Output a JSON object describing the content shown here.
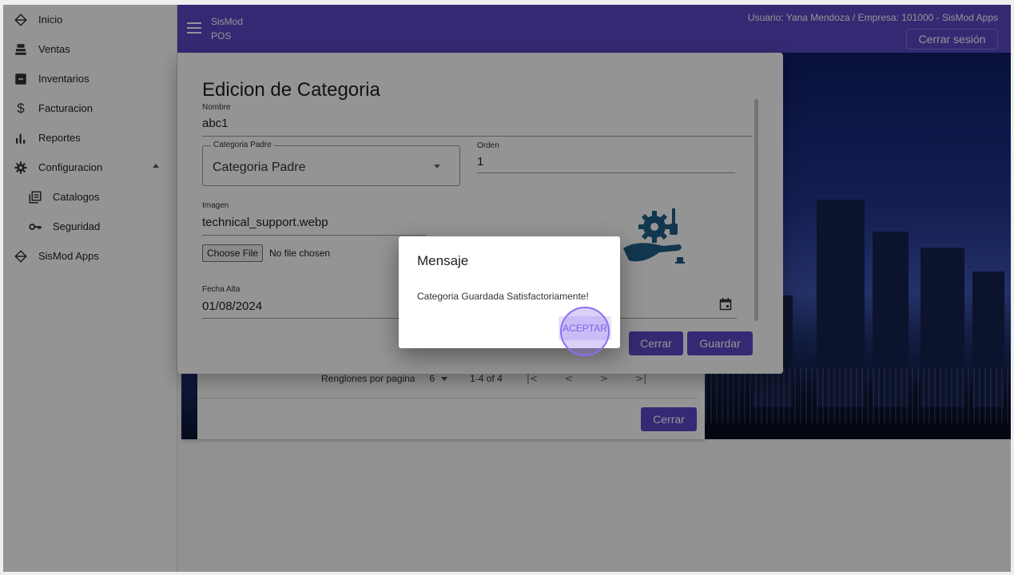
{
  "sidebar": {
    "items": [
      {
        "label": "Inicio",
        "icon": "box-outline-icon"
      },
      {
        "label": "Ventas",
        "icon": "cash-register-icon"
      },
      {
        "label": "Inventarios",
        "icon": "archive-icon"
      },
      {
        "label": "Facturacion",
        "icon": "dollar-icon"
      },
      {
        "label": "Reportes",
        "icon": "bar-chart-icon"
      },
      {
        "label": "Configuracion",
        "icon": "gear-icon"
      },
      {
        "label": "Catalogos",
        "icon": "library-books-icon"
      },
      {
        "label": "Seguridad",
        "icon": "key-icon"
      },
      {
        "label": "SisMod Apps",
        "icon": "box-outline-icon"
      }
    ]
  },
  "appbar": {
    "title_line1": "SisMod",
    "title_line2": "POS",
    "user_info": "Usuario: Yana Mendoza / Empresa: 101000 - SisMod Apps",
    "logout_label": "Cerrar sesión"
  },
  "back_panel": {
    "rows_per_page_label": "Renglones por pagina",
    "rows_per_page_value": "6",
    "range": "1-4 of 4",
    "close_label": "Cerrar"
  },
  "edit_dialog": {
    "title": "Edicion de Categoria",
    "nombre_label": "Nombre",
    "nombre_value": "abc1",
    "categoria_padre_label": "Categoria Padre",
    "categoria_padre_value": "Categoria Padre",
    "orden_label": "Orden",
    "orden_value": "1",
    "imagen_label": "Imagen",
    "imagen_value": "technical_support.webp",
    "choose_file_label": "Choose File",
    "no_file_label": "No file chosen",
    "fecha_alta_label": "Fecha Alta",
    "fecha_alta_value": "01/08/2024",
    "close_label": "Cerrar",
    "save_label": "Guardar"
  },
  "message_dialog": {
    "title": "Mensaje",
    "body": "Categoria Guardada Satisfactoriamente!",
    "accept_label": "ACEPTAR"
  },
  "colors": {
    "primary": "#5a49c6",
    "accent_ripple": "#8c6ef0",
    "icon_blue": "#1f5f87"
  }
}
